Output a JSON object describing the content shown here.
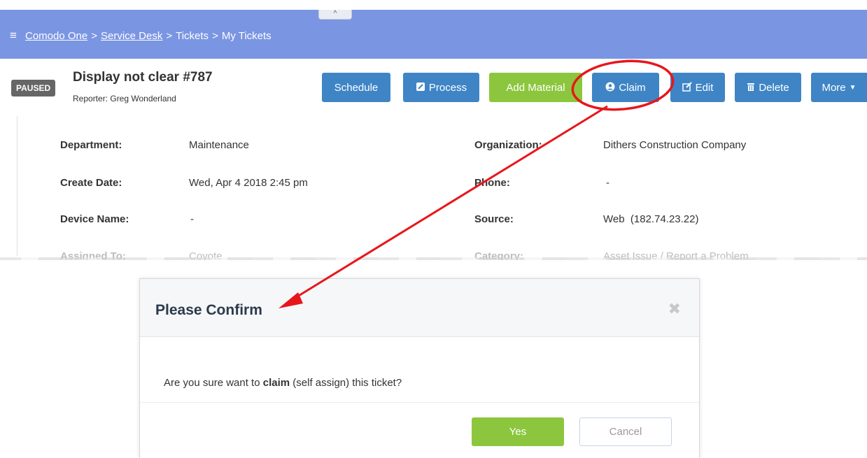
{
  "breadcrumb": {
    "items": [
      "Comodo One",
      "Service Desk",
      "Tickets",
      "My Tickets"
    ],
    "separator": ">"
  },
  "collapse_glyph": "^",
  "ticket": {
    "status": "PAUSED",
    "title": "Display not clear #787",
    "reporter": "Reporter: Greg Wonderland"
  },
  "toolbar": {
    "schedule": "Schedule",
    "process": "Process",
    "add_material": "Add Material",
    "claim": "Claim",
    "edit": "Edit",
    "delete": "Delete",
    "more": "More"
  },
  "details": {
    "department_label": "Department:",
    "department_value": "Maintenance",
    "create_date_label": "Create Date:",
    "create_date_value": "Wed, Apr 4 2018 2:45 pm",
    "device_name_label": "Device Name:",
    "device_name_value": "-",
    "organization_label": "Organization:",
    "organization_value": "Dithers Construction Company",
    "phone_label": "Phone:",
    "phone_value": "-",
    "source_label": "Source:",
    "source_value": "Web  (182.74.23.22)",
    "assigned_to_label": "Assigned To:",
    "assigned_to_value": "Coyote",
    "category_label": "Category:",
    "category_value": "Asset Issue / Report a Problem"
  },
  "modal": {
    "title": "Please Confirm",
    "close_glyph": "✖",
    "message_pre": "Are you sure want to ",
    "message_bold": "claim",
    "message_post": " (self assign) this ticket?",
    "yes": "Yes",
    "cancel": "Cancel"
  },
  "colors": {
    "topbar": "#7a95e2",
    "button_blue": "#3f85c6",
    "button_green": "#8cc63e",
    "annotation_red": "#e8161b"
  }
}
